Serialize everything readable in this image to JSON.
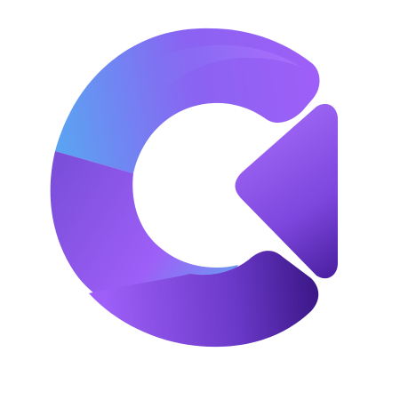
{
  "logo": {
    "icon": "letter-c-with-play-arrow-logo",
    "background": "#ffffff",
    "colors": {
      "blue": "#5aa4f2",
      "violet": "#8a5cf0",
      "purple": "#9d5ff7",
      "deep_purple": "#4a1fa0",
      "darkest": "#3a1686"
    }
  }
}
